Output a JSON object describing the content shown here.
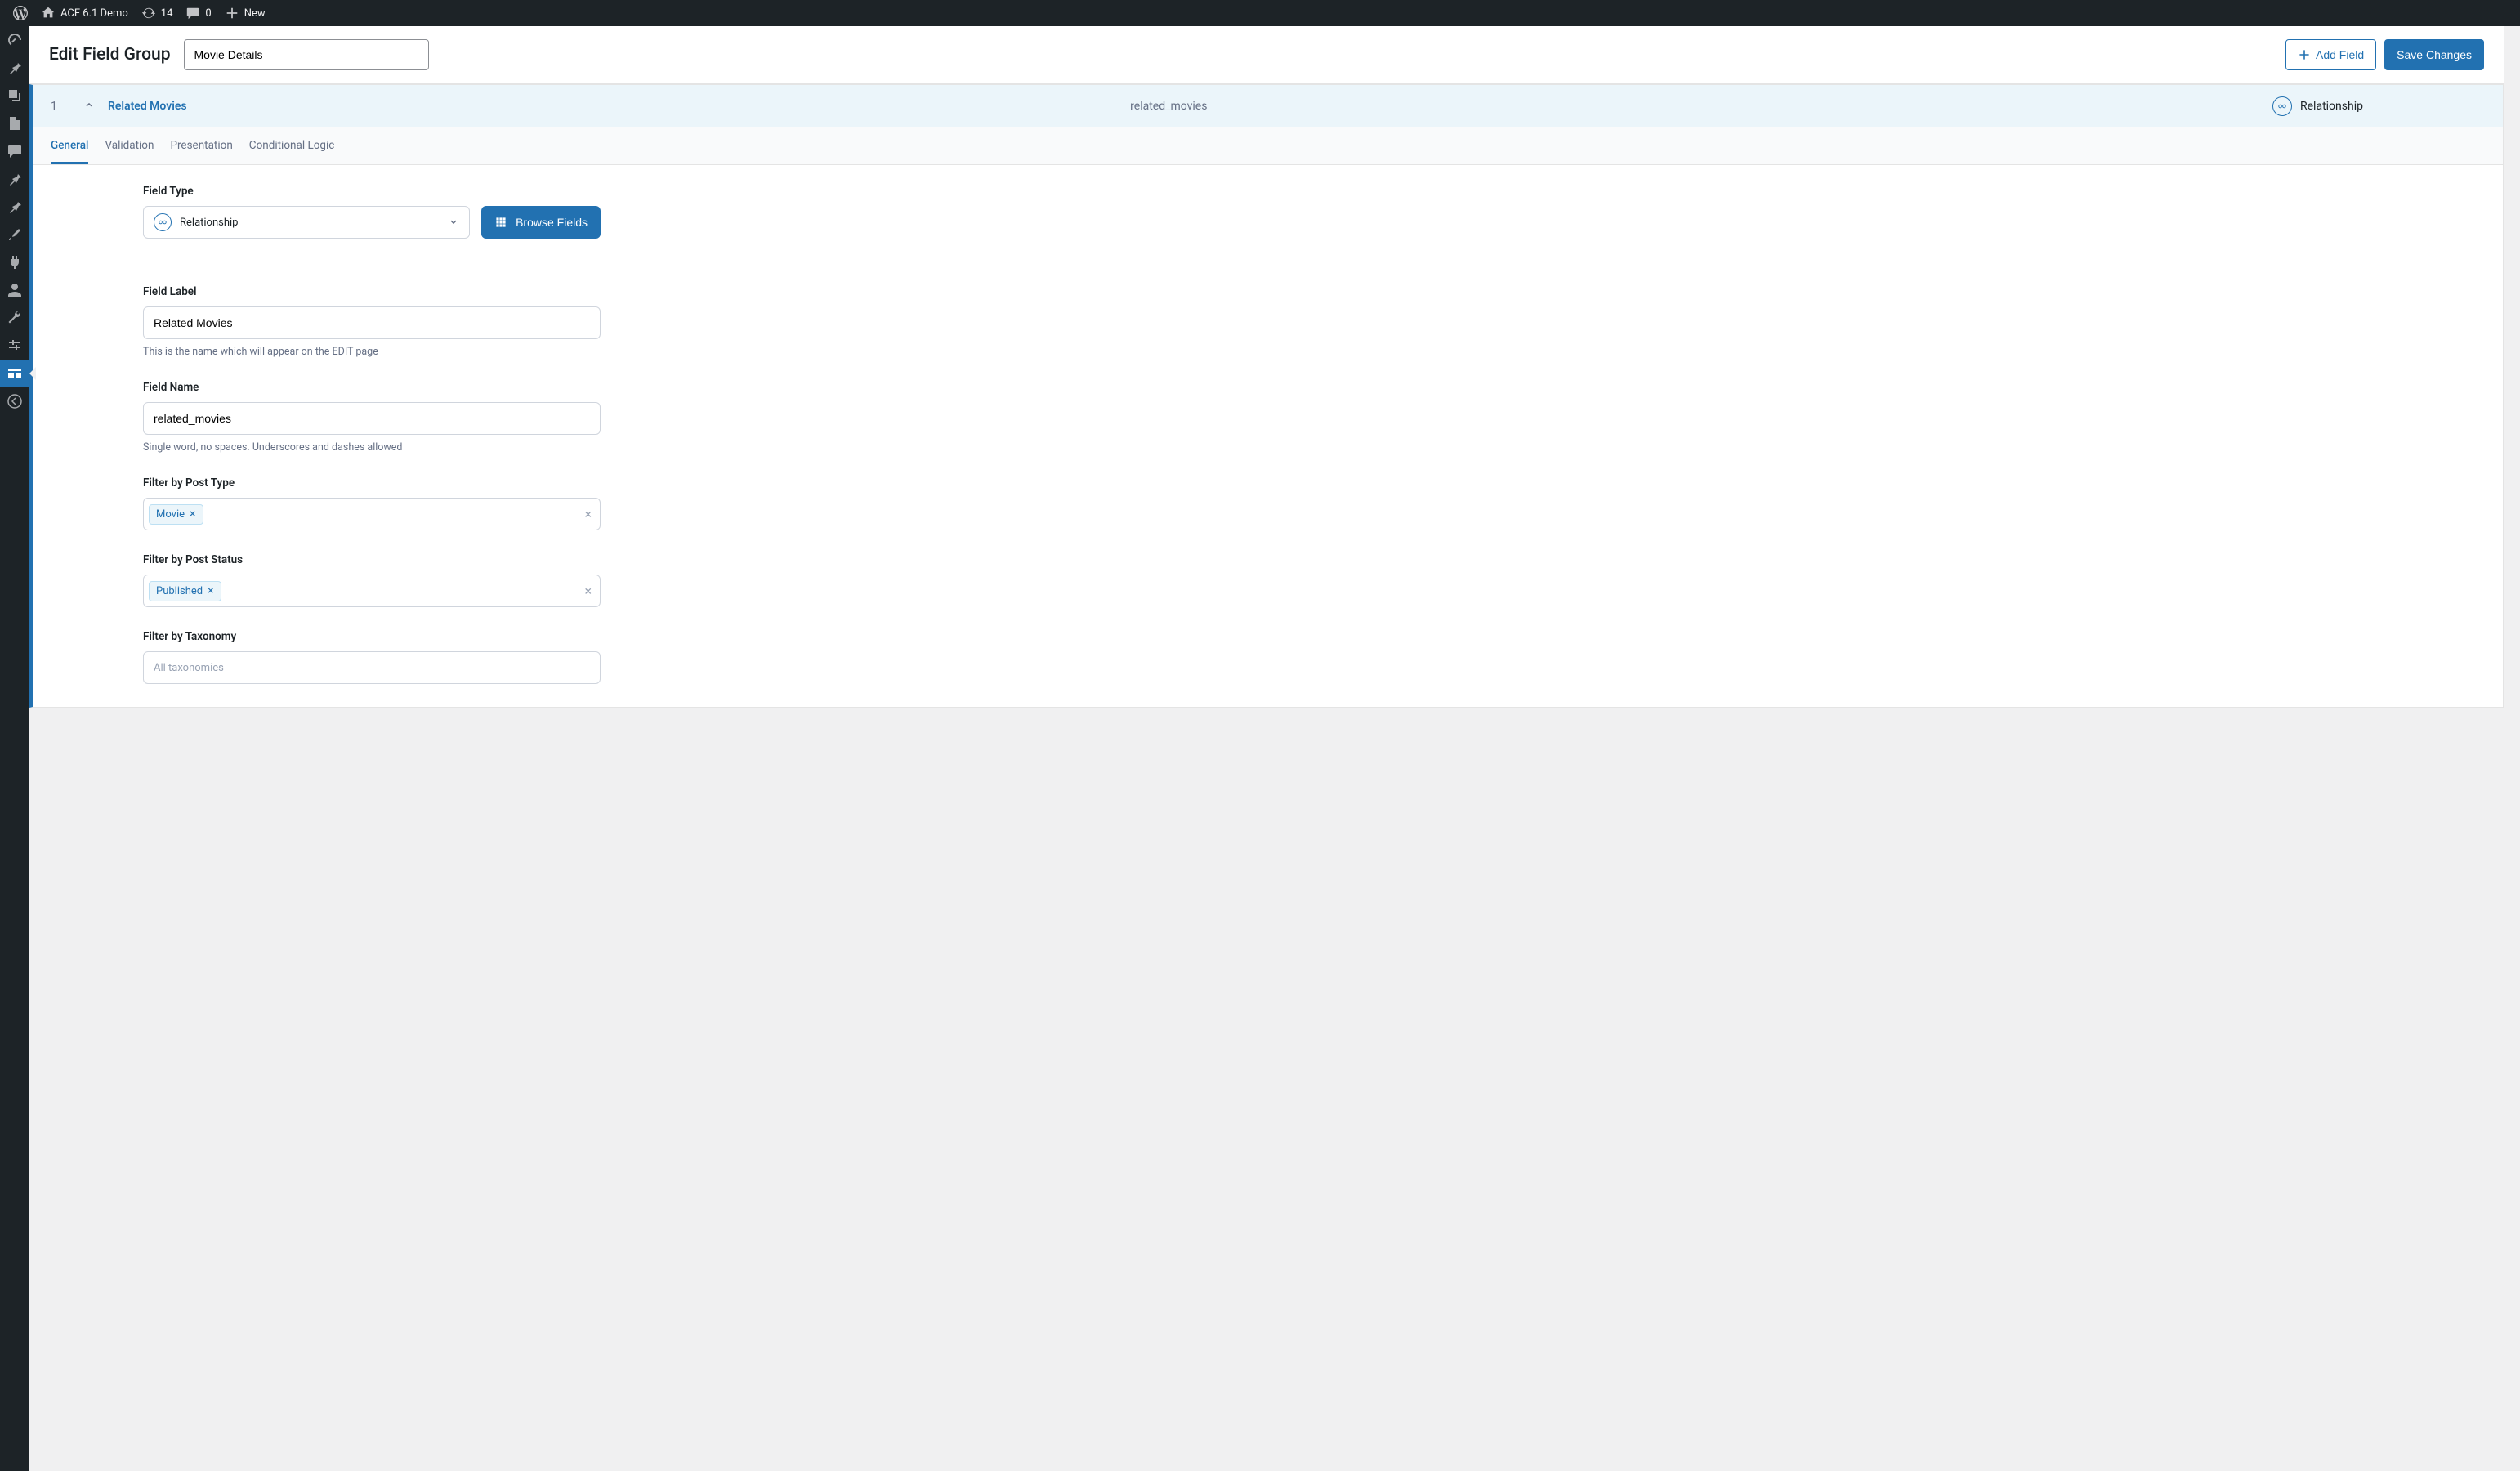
{
  "adminbar": {
    "site_name": "ACF 6.1 Demo",
    "updates_count": "14",
    "comments_count": "0",
    "new_label": "New"
  },
  "page": {
    "title": "Edit Field Group",
    "group_name": "Movie Details",
    "add_field_label": "Add Field",
    "save_label": "Save Changes"
  },
  "field_header": {
    "order": "1",
    "label": "Related Movies",
    "key": "related_movies",
    "type": "Relationship"
  },
  "tabs": {
    "general": "General",
    "validation": "Validation",
    "presentation": "Presentation",
    "conditional": "Conditional Logic"
  },
  "settings": {
    "field_type": {
      "label": "Field Type",
      "value": "Relationship",
      "browse_label": "Browse Fields"
    },
    "field_label": {
      "label": "Field Label",
      "value": "Related Movies",
      "help": "This is the name which will appear on the EDIT page"
    },
    "field_name": {
      "label": "Field Name",
      "value": "related_movies",
      "help": "Single word, no spaces. Underscores and dashes allowed"
    },
    "filter_post_type": {
      "label": "Filter by Post Type",
      "tag": "Movie"
    },
    "filter_post_status": {
      "label": "Filter by Post Status",
      "tag": "Published"
    },
    "filter_taxonomy": {
      "label": "Filter by Taxonomy",
      "placeholder": "All taxonomies"
    }
  }
}
